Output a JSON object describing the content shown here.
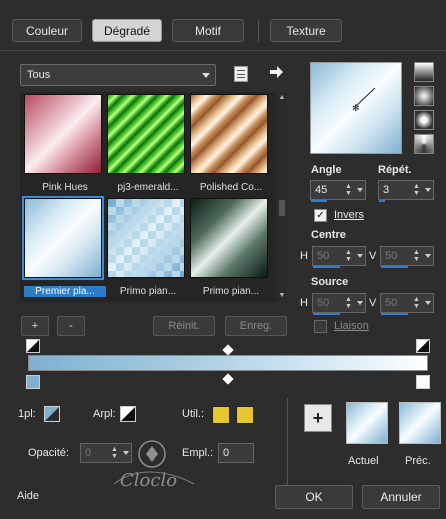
{
  "tabs": [
    {
      "label": "Couleur"
    },
    {
      "label": "Dégradé"
    },
    {
      "label": "Motif"
    },
    {
      "label": "Texture"
    }
  ],
  "category": {
    "selected": "Tous"
  },
  "gradients": [
    {
      "label": "Pink Hues"
    },
    {
      "label": "pj3-emerald..."
    },
    {
      "label": "Polished Co..."
    },
    {
      "label": "Premier pla..."
    },
    {
      "label": "Primo pian..."
    },
    {
      "label": "Primo pian..."
    }
  ],
  "gradient_buttons": {
    "add": "+",
    "remove": "-",
    "reset": "Réinit.",
    "save": "Enreg."
  },
  "angle": {
    "label": "Angle",
    "value": "45"
  },
  "repeat": {
    "label": "Répét.",
    "value": "3"
  },
  "invert": {
    "label": "Invers",
    "checked": true
  },
  "center": {
    "label": "Centre",
    "h_label": "H",
    "h_value": "50",
    "v_label": "V",
    "v_value": "50"
  },
  "source": {
    "label": "Source",
    "h_label": "H",
    "h_value": "50",
    "v_label": "V",
    "v_value": "50"
  },
  "link": {
    "label": "Liaison"
  },
  "markers": {
    "first_label": "1pl:",
    "back_label": "Arpl:",
    "use_label": "Util.:",
    "opacity_label": "Opacité:",
    "opacity_value": "0",
    "location_label": "Empl.:",
    "location_value": "0"
  },
  "preview": {
    "current_label": "Actuel",
    "previous_label": "Préc."
  },
  "watermark": {
    "text": "Cloclo"
  },
  "footer": {
    "help": "Aide",
    "ok": "OK",
    "cancel": "Annuler"
  },
  "colors": {
    "accent": "#2f7fd0",
    "use_swatch": "#e7c52c"
  }
}
